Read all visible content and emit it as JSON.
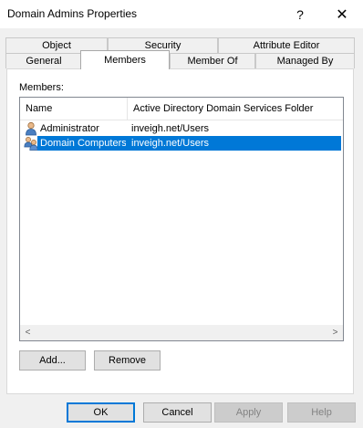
{
  "window": {
    "title": "Domain Admins Properties",
    "help_glyph": "?",
    "close_glyph": "✕"
  },
  "tabs": {
    "row1": [
      "Object",
      "Security",
      "Attribute Editor"
    ],
    "row2": [
      "General",
      "Members",
      "Member Of",
      "Managed By"
    ],
    "selected": "Members"
  },
  "members": {
    "label": "Members:",
    "columns": [
      "Name",
      "Active Directory Domain Services Folder"
    ],
    "rows": [
      {
        "name": "Administrator",
        "folder": "inveigh.net/Users",
        "icon": "user-icon"
      },
      {
        "name": "Domain Computers",
        "folder": "inveigh.net/Users",
        "icon": "group-icon",
        "selected": true
      }
    ]
  },
  "buttons": {
    "add": "Add...",
    "remove": "Remove",
    "ok": "OK",
    "cancel": "Cancel",
    "apply": "Apply",
    "help": "Help"
  },
  "scroll": {
    "left": "<",
    "right": ">"
  }
}
